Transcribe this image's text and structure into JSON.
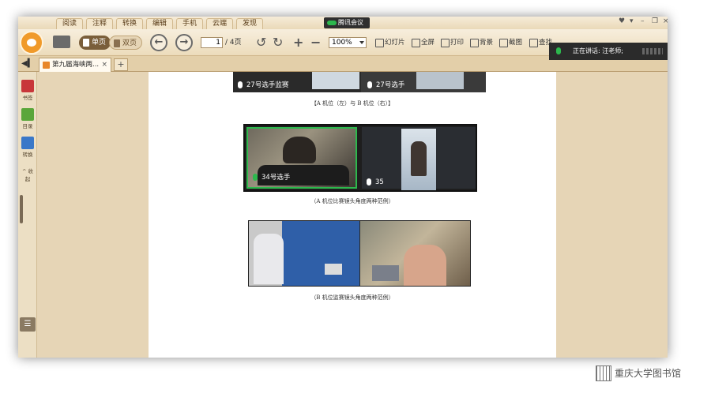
{
  "menu": {
    "tabs": [
      "阅读",
      "注释",
      "转换",
      "编辑",
      "手机",
      "云端",
      "发现"
    ],
    "meeting": "腾讯会议"
  },
  "toolbar": {
    "single_page": "单页",
    "double_page": "双页",
    "page_current": "1",
    "page_total": "/ 4页",
    "zoom": "100%",
    "buttons": [
      "幻灯片",
      "全屏",
      "打印",
      "背景",
      "截图",
      "查找"
    ]
  },
  "speaker": {
    "text": "正在讲话: 汪老师;"
  },
  "tabs": {
    "doc_title": "第九届海峡两...",
    "close": "×",
    "new": "+"
  },
  "sidebar": {
    "items": [
      "书签",
      "目录",
      "转换",
      "^ 收起"
    ]
  },
  "document": {
    "top_videos": [
      "27号选手监赛",
      "27号选手"
    ],
    "caption_1": "【A 机位（左）与 B 机位（右）】",
    "mid_videos": [
      "34号选手",
      "35"
    ],
    "caption_2": "（A 机位比赛镜头角度两种范例）",
    "caption_3": "（B 机位监赛镜头角度两种范例）"
  },
  "watermark": "重庆大学图书馆"
}
